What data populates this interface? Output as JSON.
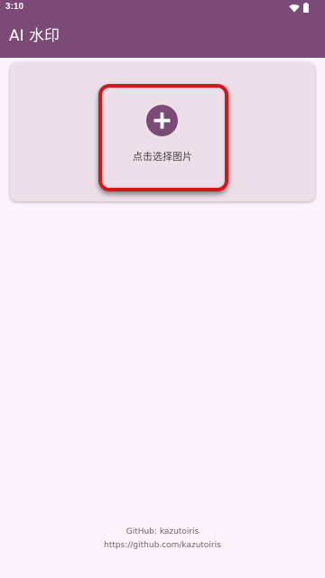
{
  "status_bar": {
    "time": "3:10",
    "icons": [
      "wifi-icon",
      "battery-icon"
    ]
  },
  "app_bar": {
    "title": "AI 水印",
    "color": "#7b4a76"
  },
  "image_picker": {
    "icon": "plus-circle-icon",
    "label": "点击选择图片",
    "highlight_color": "#d4151b"
  },
  "footer": {
    "github": "GitHub: kazutoiris",
    "url": "https://github.com/kazutoiris"
  },
  "colors": {
    "primary": "#7b4a76",
    "background": "#fcf3fc",
    "card": "#ecdfe9"
  }
}
